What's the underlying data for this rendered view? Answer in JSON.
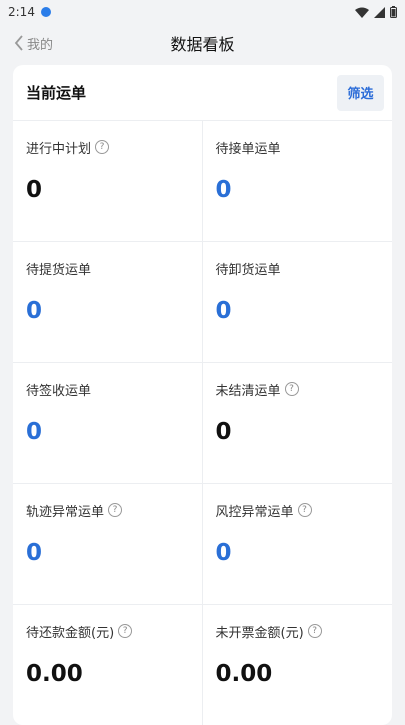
{
  "status": {
    "time": "2:14"
  },
  "nav": {
    "back_label": "我的",
    "title": "数据看板"
  },
  "card": {
    "title": "当前运单",
    "filter_label": "筛选",
    "metrics": [
      {
        "label": "进行中计划",
        "value": "0",
        "help": true,
        "color": "#111111"
      },
      {
        "label": "待接单运单",
        "value": "0",
        "help": false,
        "color": "#2a6fd6"
      },
      {
        "label": "待提货运单",
        "value": "0",
        "help": false,
        "color": "#2a6fd6"
      },
      {
        "label": "待卸货运单",
        "value": "0",
        "help": false,
        "color": "#2a6fd6"
      },
      {
        "label": "待签收运单",
        "value": "0",
        "help": false,
        "color": "#2a6fd6"
      },
      {
        "label": "未结清运单",
        "value": "0",
        "help": true,
        "color": "#111111"
      },
      {
        "label": "轨迹异常运单",
        "value": "0",
        "help": true,
        "color": "#2a6fd6"
      },
      {
        "label": "风控异常运单",
        "value": "0",
        "help": true,
        "color": "#2a6fd6"
      },
      {
        "label": "待还款金额(元)",
        "value": "0.00",
        "help": true,
        "color": "#111111"
      },
      {
        "label": "未开票金额(元)",
        "value": "0.00",
        "help": true,
        "color": "#111111"
      }
    ]
  }
}
